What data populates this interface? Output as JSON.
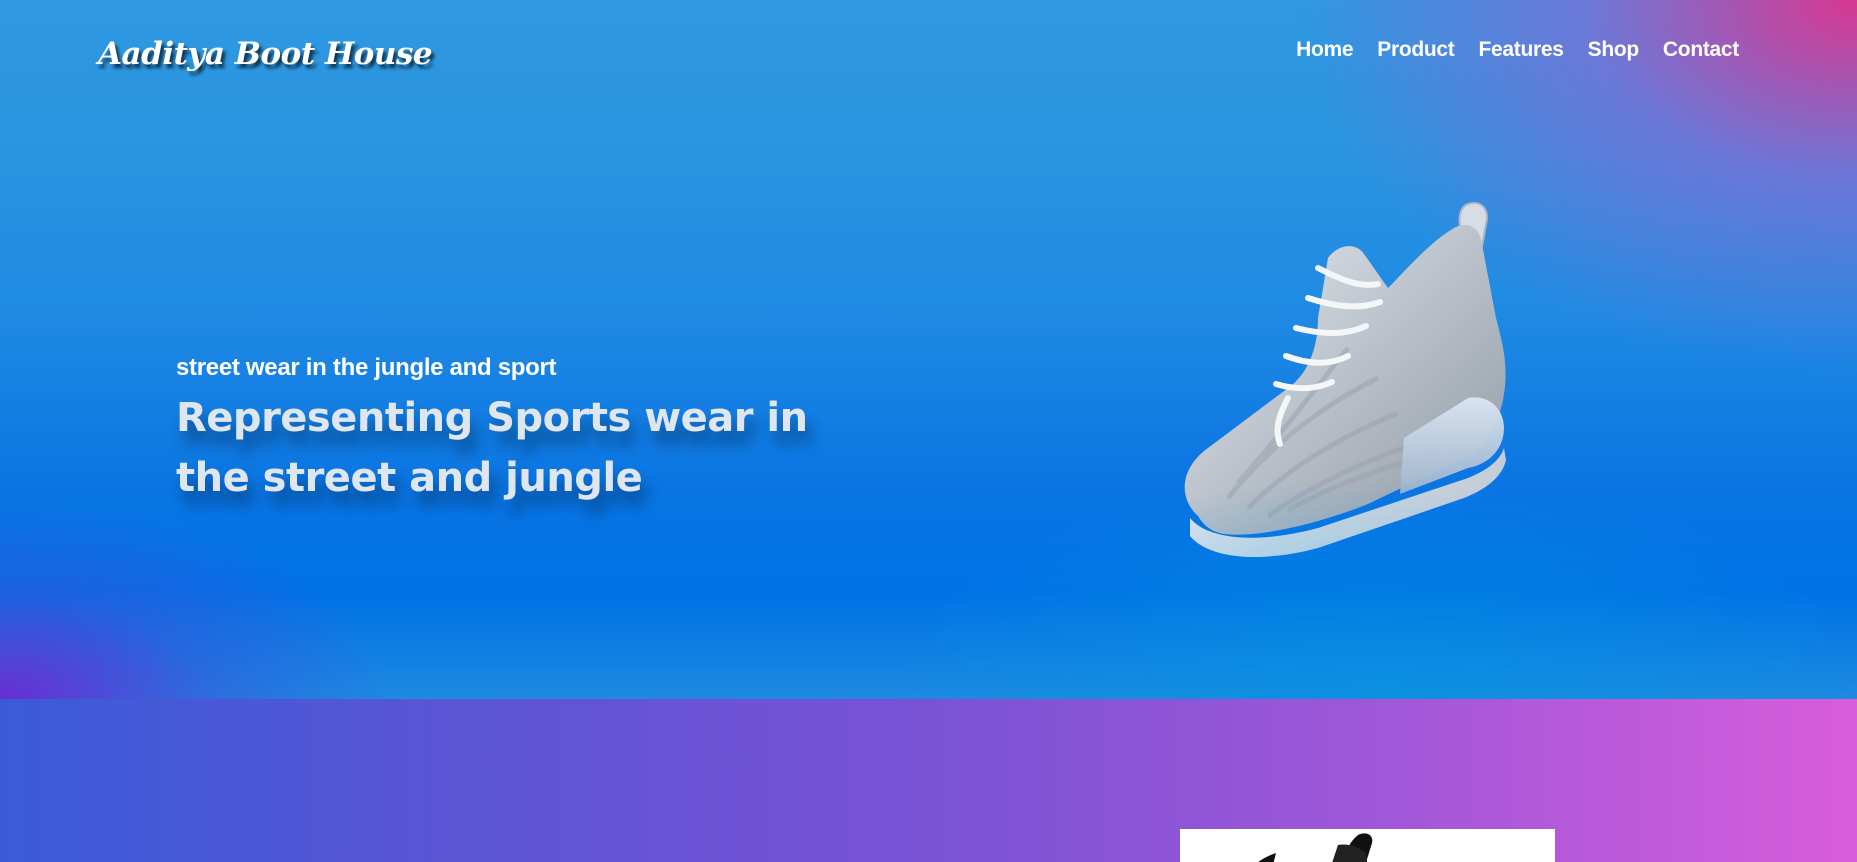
{
  "brand": {
    "logo_text": "Aaditya Boot House"
  },
  "nav": {
    "items": [
      {
        "label": "Home"
      },
      {
        "label": "Product"
      },
      {
        "label": "Features"
      },
      {
        "label": "Shop"
      },
      {
        "label": "Contact"
      }
    ]
  },
  "hero": {
    "tagline": "street wear in the jungle and sport",
    "headline": "Representing Sports wear in the street and jungle",
    "image_icon": "sneaker-image"
  },
  "colors": {
    "hero_blue": "#1f8ae3",
    "hero_pink": "#e1328c",
    "section_purple": "#7a52d6",
    "section_pink": "#d85ddc"
  },
  "products": {
    "first_card_icon": "shoe-product-image"
  }
}
